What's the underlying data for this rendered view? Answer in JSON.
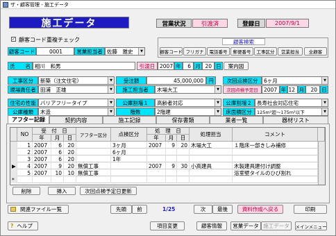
{
  "window": {
    "title": "ザ・顧客管理 - 施工データ"
  },
  "header": {
    "main_title": "施工データ",
    "status_label": "営業状況",
    "status_value": "引渡済",
    "reg_label": "登録日",
    "reg_value": "2007/9/1"
  },
  "dup_check": {
    "label": "顧客コード重複チェック",
    "checked": true
  },
  "search": {
    "title": "顧客検索",
    "buttons": [
      "顧客コード",
      "フリガナ",
      "電話番号",
      "郵便番号",
      "工事区分",
      "営業担当",
      "全顧客"
    ]
  },
  "customer": {
    "code_label": "顧客コード",
    "code_value": "0001",
    "sales_label": "営業担当者",
    "sales_value": "佐藤　雅史",
    "name_label": "氏　　名",
    "name_value": "相川　和男",
    "handover_label": "引渡日",
    "handover_year": "2007",
    "year_unit": "年",
    "handover_month": "6",
    "month_unit": "月",
    "handover_day": "20",
    "day_unit": "日",
    "guide_label": "案内図"
  },
  "work": {
    "type_label": "工事区分",
    "type_value": "新築（注文住宅）",
    "amount_label": "受注額",
    "amount_value": "45,000,000",
    "yen": "円",
    "next_label": "次回点検区分",
    "next_value": "6ヶ月",
    "site_label": "現場責任者",
    "site_value": "田浦　正雄",
    "builder_label": "施工担当者",
    "builder_value": "木場大工",
    "next_date_label": "次回点検予定日",
    "next_year": "2007",
    "next_month": "12",
    "next_day": "20",
    "perf_label": "住宅の性能",
    "perf_value": "バリアフリータイプ",
    "pub1_label": "公庫割増１",
    "pub1_value": "高齢者対応",
    "pub2_label": "公庫割増２",
    "pub2_value": "長寿社会対応住宅",
    "pubtype_label": "公庫種類",
    "pubtype_value": "木造",
    "floors_label": "階数",
    "floors_value": "2階建",
    "area_label": "床面積区分",
    "area_value": "125m²超～175m²以下"
  },
  "tabs": [
    "アフター記録",
    "契約内容",
    "施工記録",
    "保存書類",
    "業者一覧",
    "器材リスト"
  ],
  "table": {
    "headers": {
      "no": "NO",
      "received": "受　付　日",
      "type": "アフター区分",
      "inspection": "点検区分",
      "processed": "処　理　日",
      "staff": "処理担当",
      "comment": "コメント",
      "year": "年",
      "month": "月",
      "day": "日"
    },
    "rows": [
      {
        "no": "1",
        "ry": "2007",
        "rm": "6",
        "rd": "20",
        "type": "",
        "insp": "3ヶ月",
        "py": "2007",
        "pm": "9",
        "pd": "20",
        "staff": "木場大工",
        "comment": "１階床一部きしみ補修"
      },
      {
        "no": "2",
        "ry": "2007",
        "rm": "6",
        "rd": "20",
        "type": "",
        "insp": "6ヶ月",
        "py": "",
        "pm": "",
        "pd": "",
        "staff": "",
        "comment": ""
      },
      {
        "no": "3",
        "ry": "2007",
        "rm": "6",
        "rd": "20",
        "type": "",
        "insp": "1年",
        "py": "",
        "pm": "",
        "pd": "",
        "staff": "",
        "comment": ""
      },
      {
        "no": "4",
        "ry": "2007",
        "rm": "9",
        "rd": "20",
        "type": "無償工事",
        "insp": "",
        "py": "2007",
        "pm": "9",
        "pd": "30",
        "staff": "小高建具",
        "comment": "木製建具建付け調整"
      },
      {
        "no": "5",
        "ry": "2007",
        "rm": "10",
        "rd": "10",
        "type": "無償工事",
        "insp": "",
        "py": "",
        "pm": "",
        "pd": "",
        "staff": "",
        "comment": "浴室壁タイルのひび割れ"
      }
    ],
    "new_row_marker": "*",
    "current_marker": "▶"
  },
  "grid_buttons": {
    "delete": "削除",
    "insert": "挿入",
    "update": "次回点検予定日更新"
  },
  "footer": {
    "related": "関連ファイル一覧",
    "first": "先頭",
    "prev": "前",
    "page": "1/25",
    "next": "次",
    "last": "最後",
    "back": "資料作成へ戻る",
    "print": "印刷",
    "help": "ヘルプ",
    "change": "項目変更",
    "cust_info": "顧客情報",
    "sales_data": "営業データ",
    "build_data": "施工データ",
    "main_menu": "メインメニュー"
  },
  "colors": {
    "title_bg": "#1c1cc0",
    "label_bg": "#00e5ff",
    "status_pink": "#ffd7e6",
    "status_text": "#c0003c"
  }
}
